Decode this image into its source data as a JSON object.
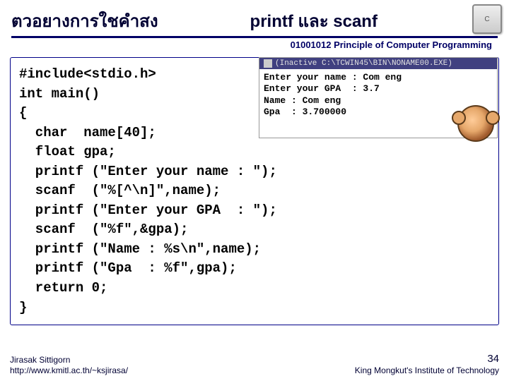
{
  "header": {
    "title_left": "ตวอยางการใชคำสง",
    "title_right": "printf และ scanf",
    "subtitle": "01001012 Principle of Computer Programming",
    "badge": "C"
  },
  "code": "#include<stdio.h>\nint main()\n{\n  char  name[40];\n  float gpa;\n  printf (\"Enter your name : \");\n  scanf  (\"%[^\\n]\",name);\n  printf (\"Enter your GPA  : \");\n  scanf  (\"%f\",&gpa);\n  printf (\"Name : %s\\n\",name);\n  printf (\"Gpa  : %f\",gpa);\n  return 0;\n}",
  "console": {
    "title": "(Inactive C:\\TCWIN45\\BIN\\NONAME00.EXE)",
    "body": "Enter your name : Com eng\nEnter your GPA  : 3.7\nName : Com eng\nGpa  : 3.700000"
  },
  "footer": {
    "author": "Jirasak Sittigorn",
    "url": "http://www.kmitl.ac.th/~ksjirasa/",
    "slide_number": "34",
    "institution": "King Mongkut's Institute of Technology"
  }
}
